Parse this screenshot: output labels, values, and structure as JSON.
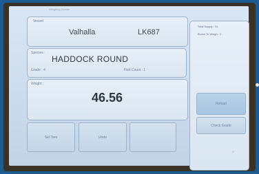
{
  "vessel": {
    "label": "Vessel",
    "name": "Valhalla",
    "code": "LK687"
  },
  "species": {
    "label": "Species :",
    "name": "HADDOCK ROUND",
    "grade_label": "Grade : 4",
    "fish_count_label": "Fish Count : 1"
  },
  "weight": {
    "label": "Weight :",
    "value": "46.56"
  },
  "side_panel": {
    "total_supply_label": "Total Supply : 31",
    "boxes_to_weigh_label": "Boxes To Weigh : 2"
  },
  "actions": {
    "reload_label": "Reload",
    "check_grade_label": "Check Grade"
  },
  "bottom_buttons": [
    {
      "label": "Set Tare"
    },
    {
      "label": "Undo"
    },
    {
      "label": ""
    }
  ]
}
